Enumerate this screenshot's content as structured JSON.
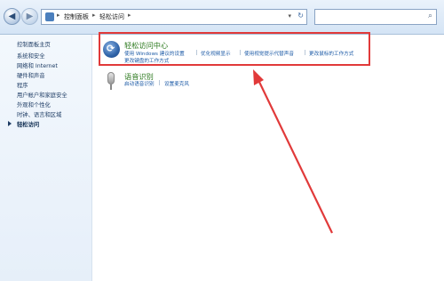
{
  "address_bar": {
    "crumbs": [
      "控制面板",
      "轻松访问"
    ],
    "back_icon": "back-arrow-icon",
    "forward_icon": "forward-arrow-icon",
    "refresh_icon": "refresh-icon",
    "dropdown_icon": "chevron-down-icon",
    "separator_icon": "chevron-right-icon"
  },
  "search": {
    "placeholder": "",
    "icon": "search-icon"
  },
  "sidebar": {
    "title": "控制面板主页",
    "items": [
      {
        "label": "系统和安全"
      },
      {
        "label": "网络和 Internet"
      },
      {
        "label": "硬件和声音"
      },
      {
        "label": "程序"
      },
      {
        "label": "用户帐户和家庭安全"
      },
      {
        "label": "外观和个性化"
      },
      {
        "label": "时钟、语言和区域"
      },
      {
        "label": "轻松访问",
        "current": true
      }
    ]
  },
  "content": {
    "ease_center": {
      "title": "轻松访问中心",
      "links": [
        "使用 Windows 建议的设置",
        "优化视频显示",
        "使用视觉提示代替声音",
        "更改鼠标的工作方式",
        "更改键盘的工作方式"
      ]
    },
    "speech": {
      "title": "语音识别",
      "links": [
        "启动语音识别",
        "设置麦克风"
      ]
    }
  },
  "annotation": {
    "color": "#e13a3a"
  }
}
